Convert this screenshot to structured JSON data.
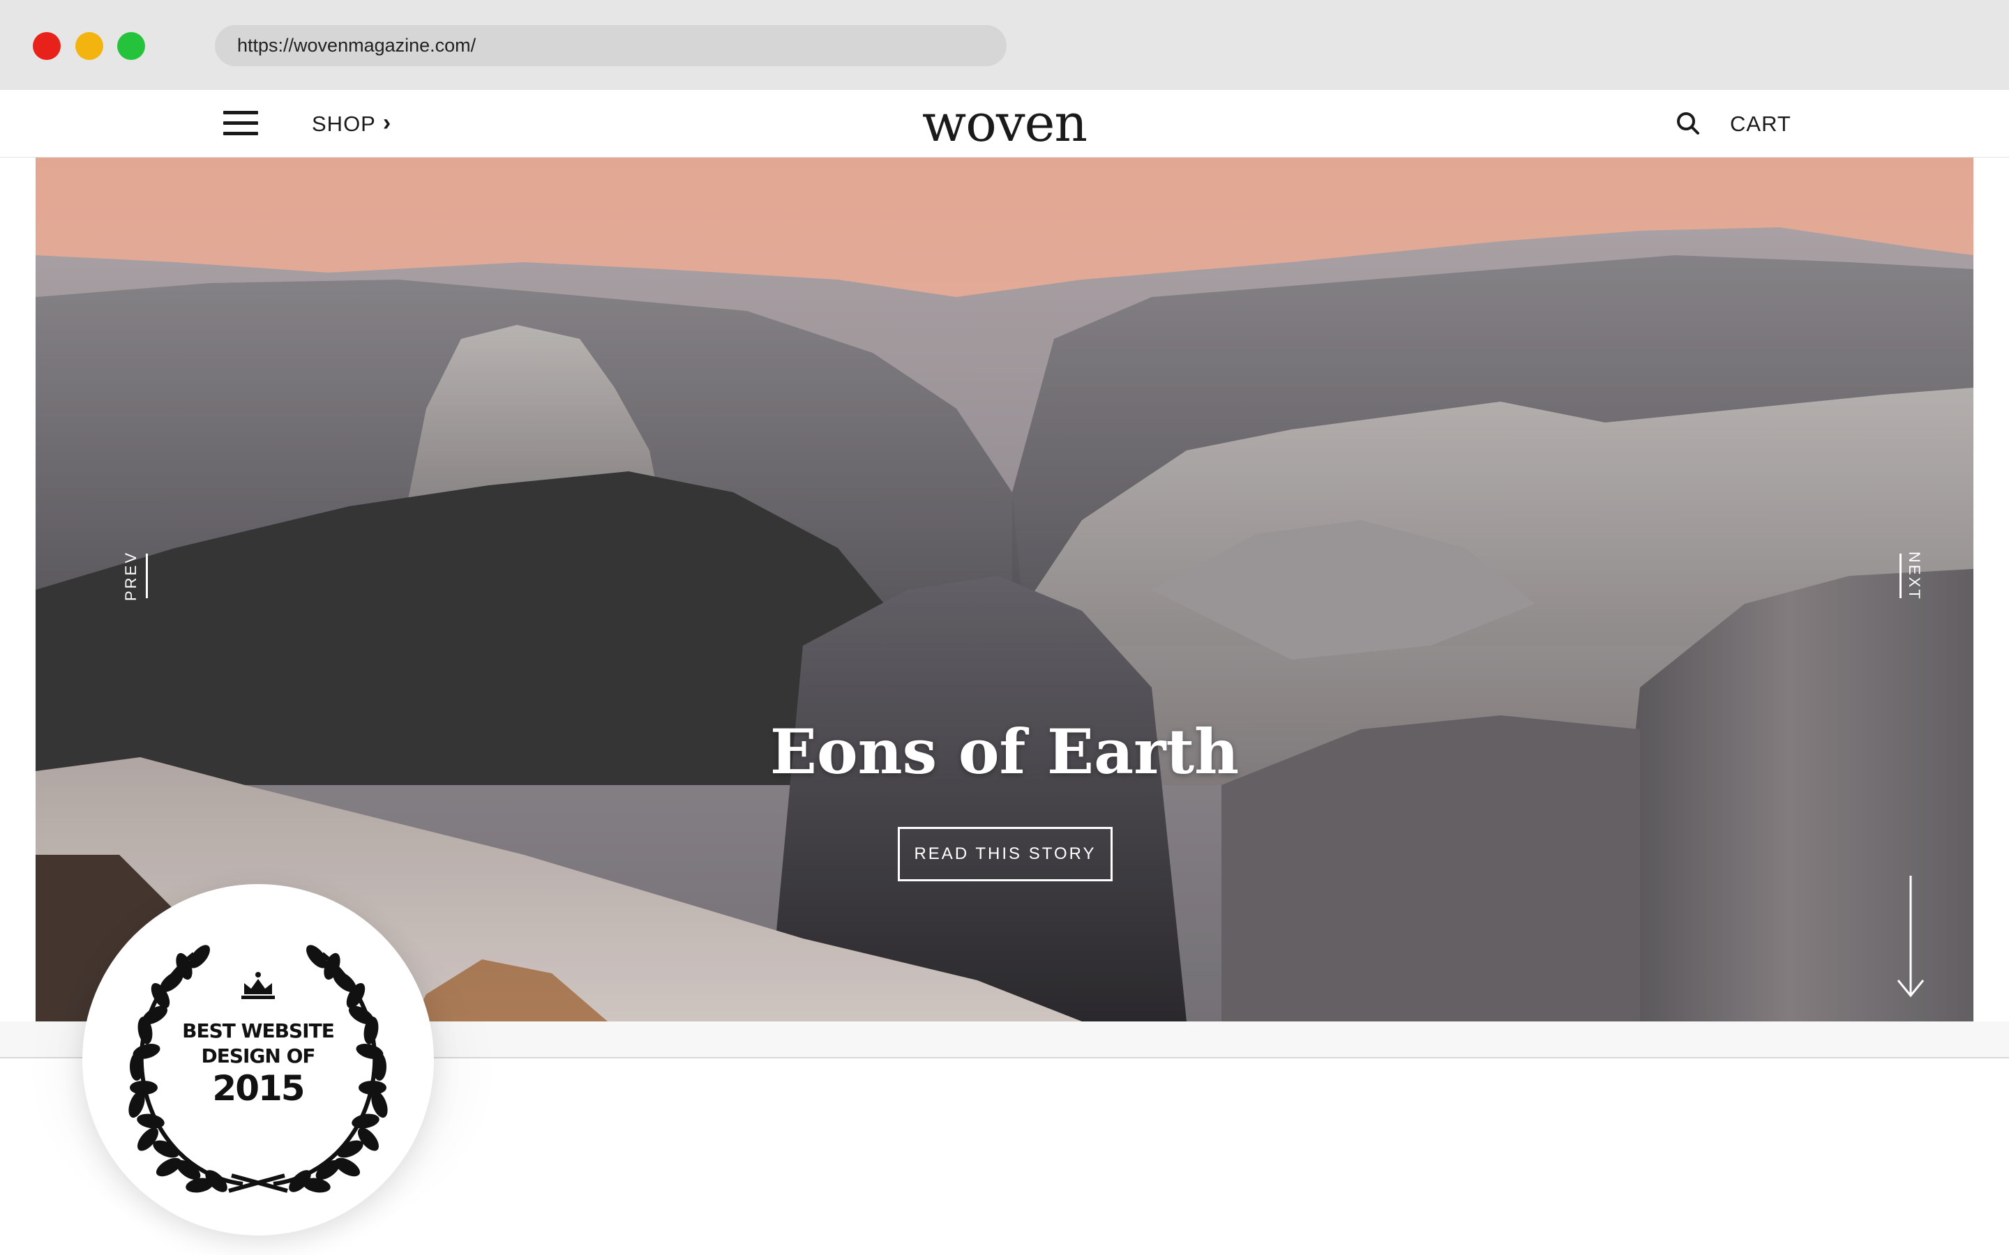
{
  "browser": {
    "url": "https://wovenmagazine.com/"
  },
  "header": {
    "shop_label": "SHOP",
    "logo": "woven",
    "cart_label": "CART"
  },
  "hero": {
    "title": "Eons of Earth",
    "cta_label": "READ THIS STORY",
    "prev_label": "PREV",
    "next_label": "NEXT"
  },
  "badge": {
    "line1": "BEST WEBSITE",
    "line2": "DESIGN OF",
    "year": "2015"
  },
  "icons": {
    "menu": "hamburger-menu-icon",
    "search": "search-icon",
    "chevron": "chevron-right-icon",
    "scroll": "arrow-down-icon",
    "crown": "crown-icon",
    "laurel": "laurel-wreath-icon"
  },
  "colors": {
    "traffic_red": "#e8221b",
    "traffic_yellow": "#f4b40f",
    "traffic_green": "#25c23c",
    "sky_top": "#f6b9a1",
    "text_dark": "#1a1a1a"
  }
}
